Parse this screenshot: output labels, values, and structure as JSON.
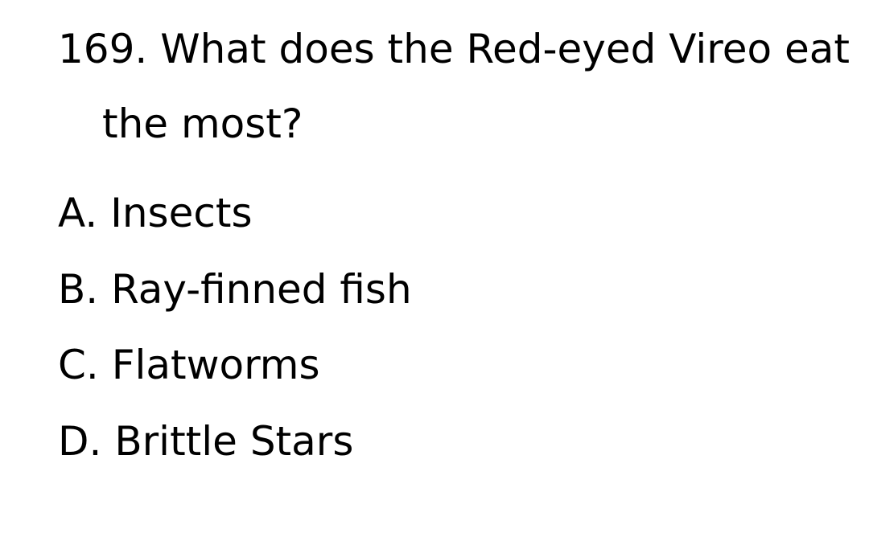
{
  "question": {
    "number": "169.",
    "text": "What does the Red-eyed Vireo eat the most?"
  },
  "choices": [
    {
      "letter": "A.",
      "text": "Insects"
    },
    {
      "letter": "B.",
      "text": "Ray-finned fish"
    },
    {
      "letter": "C.",
      "text": "Flatworms"
    },
    {
      "letter": "D.",
      "text": "Brittle Stars"
    }
  ]
}
